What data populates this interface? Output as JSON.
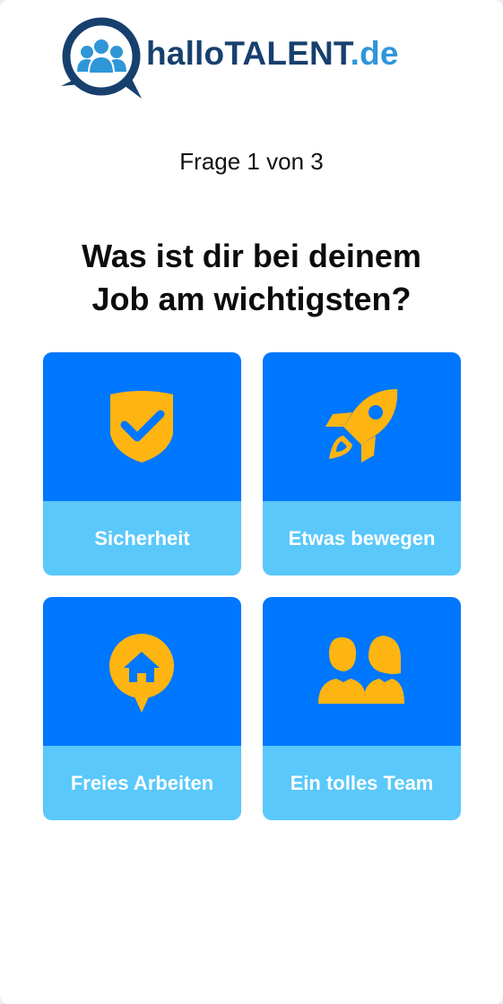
{
  "logo": {
    "text_part1": "hallo",
    "text_part2": "TALENT",
    "text_part3": ".de",
    "icon": "speech-bubble-people-icon"
  },
  "progress": {
    "text": "Frage 1 von 3"
  },
  "question": {
    "line1": "Was ist dir bei deinem",
    "line2": "Job am wichtigsten?"
  },
  "options": [
    {
      "label": "Sicherheit",
      "icon": "shield-check-icon"
    },
    {
      "label": "Etwas bewegen",
      "icon": "rocket-icon"
    },
    {
      "label": "Freies Arbeiten",
      "icon": "home-pin-icon"
    },
    {
      "label": "Ein tolles Team",
      "icon": "team-people-icon"
    }
  ],
  "colors": {
    "tile_top": "#0077ff",
    "tile_bottom": "#5ac8fb",
    "icon_fill": "#ffb511",
    "brand_dark": "#17406e",
    "brand_light": "#2f96d8"
  }
}
